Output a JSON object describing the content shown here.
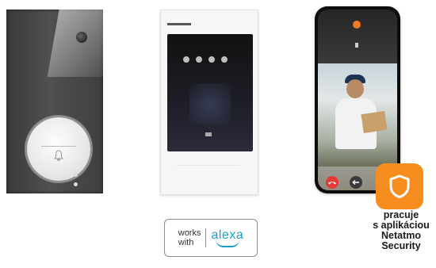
{
  "products": {
    "doorbell": {
      "icon": "bell-icon"
    },
    "indoor_monitor": {
      "icon": "monitor-icon"
    },
    "smartphone_app": {
      "icons": [
        "decline-call-icon",
        "answer-call-icon"
      ],
      "colors": {
        "decline": "#e53935",
        "answer": "#3a3a3a"
      }
    }
  },
  "badges": {
    "alexa": {
      "works_line1": "works",
      "works_line2": "with",
      "brand": "alexa",
      "brand_color": "#1aa0cf"
    },
    "netatmo": {
      "icon": "shield-icon",
      "color": "#f78d1e",
      "lines": [
        "pracuje",
        "s aplikáciou",
        "Netatmo",
        "Security"
      ]
    }
  }
}
